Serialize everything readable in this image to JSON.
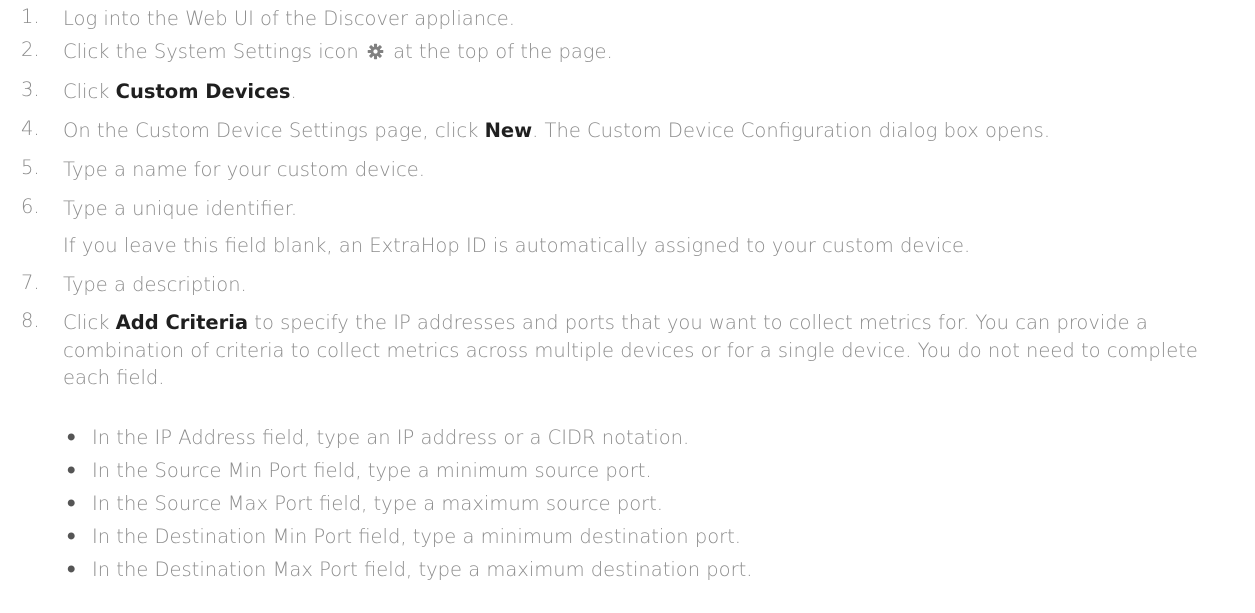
{
  "steps": [
    {
      "num": "1.",
      "text": "Log into the Web UI of the Discover appliance."
    },
    {
      "num": "2.",
      "pre": "Click the System Settings icon",
      "post": "at the top of the page.",
      "icon": "gear-icon"
    },
    {
      "num": "3.",
      "pre": "Click ",
      "strong": "Custom Devices",
      "post": "."
    },
    {
      "num": "4.",
      "pre": "On the Custom Device Settings page, click ",
      "strong": "New",
      "post": ". The Custom Device Configuration dialog box opens."
    },
    {
      "num": "5.",
      "text": "Type a name for your custom device."
    },
    {
      "num": "6.",
      "text": "Type a unique identifier.",
      "note": "If you leave this field blank, an ExtraHop ID is automatically assigned to your custom device."
    },
    {
      "num": "7.",
      "text": "Type a description."
    },
    {
      "num": "8.",
      "pre": "Click ",
      "strong": "Add Criteria",
      "post": " to specify the IP addresses and ports that you want to collect metrics for. You can provide a combination of criteria to collect metrics across multiple devices or for a single device. You do not need to complete each field."
    }
  ],
  "bullets": [
    "In the IP Address field, type an IP address or a CIDR notation.",
    "In the Source Min Port field, type a minimum source port.",
    "In the Source Max Port field, type a maximum source port.",
    "In the Destination Min Port field, type a minimum destination port.",
    "In the Destination Max Port field, type a maximum destination port."
  ],
  "bullet_glyph": "•"
}
